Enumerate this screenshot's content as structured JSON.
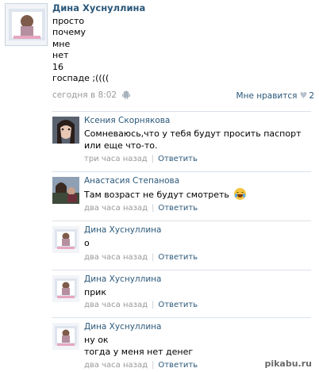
{
  "post": {
    "author": "Дина Хуснуллина",
    "lines": [
      "просто",
      "почему",
      "мне",
      "нет",
      "16",
      "госпаде ;(((("
    ],
    "time": "сегодня в 8:02",
    "likes_label": "Мне нравится",
    "likes_count": "2"
  },
  "replies": [
    {
      "name": "Ксения Скорнякова",
      "text": "Сомневаюсь,что у тебя будут просить паспорт или еще что-то.",
      "time": "три часа назад",
      "answer": "Ответить"
    },
    {
      "name": "Анастасия Степанова",
      "text": "Там возраст не будут смотреть",
      "time": "два часа назад",
      "answer": "Ответить"
    },
    {
      "name": "Дина Хуснуллина",
      "text": "о",
      "time": "два часа назад",
      "answer": "Ответить"
    },
    {
      "name": "Дина Хуснуллина",
      "text": "прик",
      "time": "два часа назад",
      "answer": "Ответить"
    },
    {
      "name": "Дина Хуснуллина",
      "text": "ну ок\nтогда у меня нет денег",
      "time": "два часа назад",
      "answer": "Ответить"
    }
  ],
  "watermark": "pikabu.ru",
  "colors": {
    "link": "#2b587a",
    "meta": "#999999",
    "separator": "#dae1e8"
  },
  "icons": [
    "android-icon",
    "heart-icon",
    "crying-laughing-emoji-icon"
  ]
}
